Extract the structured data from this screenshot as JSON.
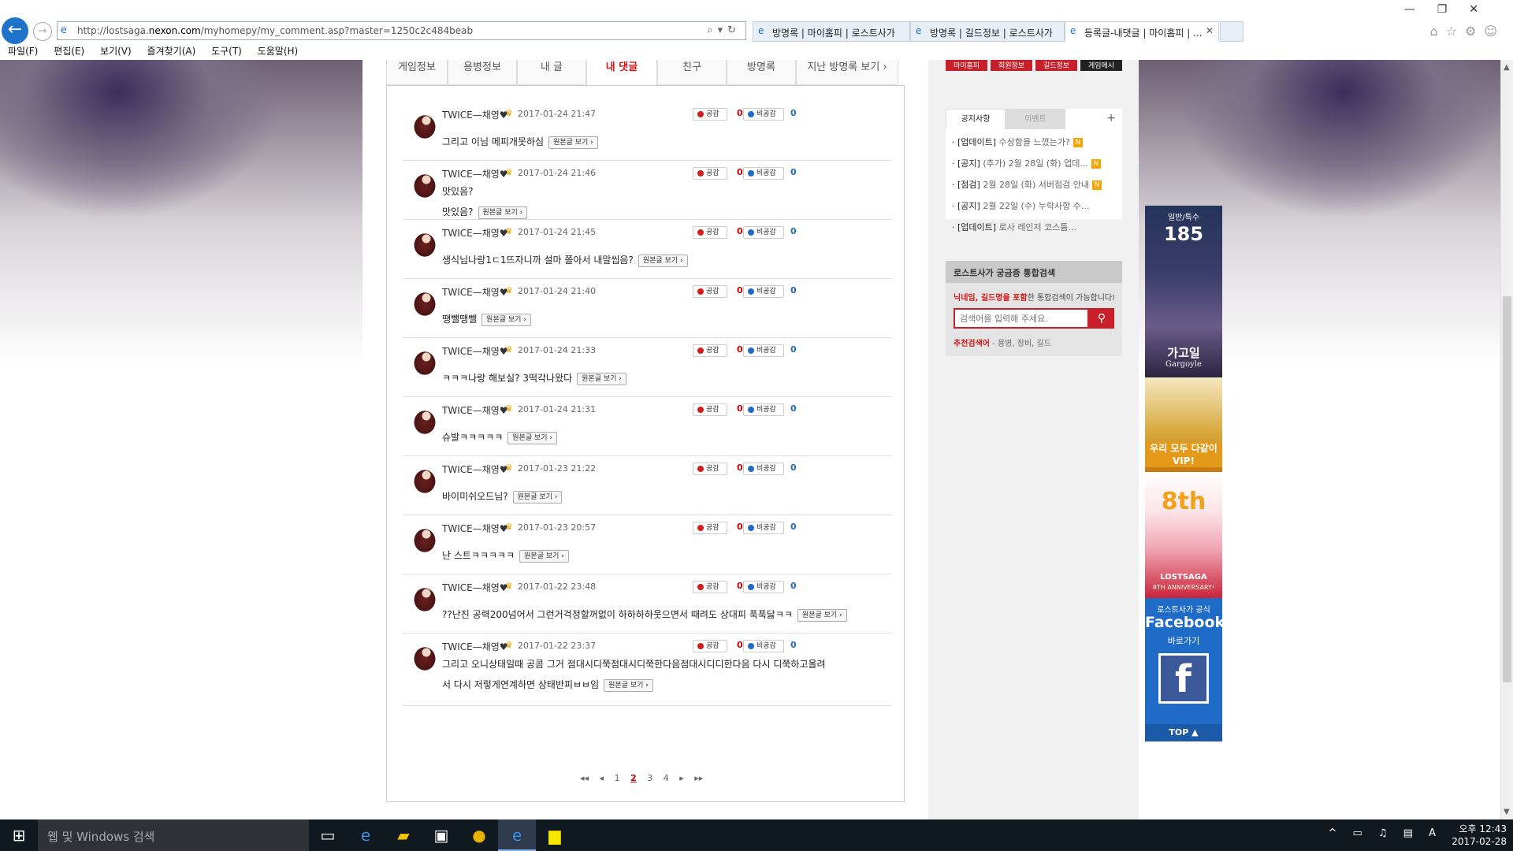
{
  "browser": {
    "url_prefix": "http://lostsaga.",
    "url_host": "nexon.com",
    "url_path": "/myhomepy/my_comment.asp?master=1250c2c484beab",
    "tabs": [
      {
        "title": "방명록 | 마이홈피 | 로스트사가"
      },
      {
        "title": "방명록 | 길드정보 | 로스트사가"
      },
      {
        "title": "등록글-내댓글 | 마이홈피 | ..."
      }
    ],
    "menu": [
      "파일(F)",
      "편집(E)",
      "보기(V)",
      "즐겨찾기(A)",
      "도구(T)",
      "도움말(H)"
    ]
  },
  "nav": {
    "tabs": [
      "게임정보",
      "용병정보",
      "내 글",
      "내 댓글",
      "친구",
      "방명록",
      "지난 방명록 보기 ›"
    ]
  },
  "comments": [
    {
      "name": "TWICE—채영♥",
      "date": "2017-01-24 21:47",
      "lines": [
        "그리고 이님 메피개못하심"
      ],
      "likes": "0",
      "dislikes": "0"
    },
    {
      "name": "TWICE—채영♥",
      "date": "2017-01-24 21:46",
      "lines": [
        "맛있음?",
        "맛있음?"
      ],
      "likes": "0",
      "dislikes": "0"
    },
    {
      "name": "TWICE—채영♥",
      "date": "2017-01-24 21:45",
      "lines": [
        "생식님나랑1ㄷ1뜨자니까 설마 쫄아서 내말씹음?"
      ],
      "likes": "0",
      "dislikes": "0"
    },
    {
      "name": "TWICE—채영♥",
      "date": "2017-01-24 21:40",
      "lines": [
        "땡뺄땡뺄"
      ],
      "likes": "0",
      "dislikes": "0"
    },
    {
      "name": "TWICE—채영♥",
      "date": "2017-01-24 21:33",
      "lines": [
        "ㅋㅋㅋ나랑 해보실? 3떡각나왔다"
      ],
      "likes": "0",
      "dislikes": "0"
    },
    {
      "name": "TWICE—채영♥",
      "date": "2017-01-24 21:31",
      "lines": [
        "슈발ㅋㅋㅋㅋㅋ"
      ],
      "likes": "0",
      "dislikes": "0"
    },
    {
      "name": "TWICE—채영♥",
      "date": "2017-01-23 21:22",
      "lines": [
        "바이미쉬오드님?"
      ],
      "likes": "0",
      "dislikes": "0"
    },
    {
      "name": "TWICE—채영♥",
      "date": "2017-01-23 20:57",
      "lines": [
        "난 스트ㅋㅋㅋㅋㅋ"
      ],
      "likes": "0",
      "dislikes": "0"
    },
    {
      "name": "TWICE—채영♥",
      "date": "2017-01-22 23:48",
      "lines": [
        "??난진 공력200넘어서 그런거걱정할꺼없이 하하하하웃으면서 때려도 상대피 푹푹닳ㅋㅋ"
      ],
      "likes": "0",
      "dislikes": "0"
    },
    {
      "name": "TWICE—채영♥",
      "date": "2017-01-22 23:37",
      "lines": [
        "그리고 오니상태일때 공콤 그거 점대시디쭉점대시디쭉한다음점대시디디한다음 다시 디쭉하고올려",
        "서 다시 저렇게연계하면 상태반피ㅂㅂ임"
      ],
      "likes": "0",
      "dislikes": "0"
    }
  ],
  "comment_ui": {
    "like_label": "공감",
    "dislike_label": "비공감",
    "original_label": "원본글 보기 ›"
  },
  "pager": {
    "first": "◂◂",
    "prev": "◂",
    "pages": [
      "1",
      "2",
      "3",
      "4"
    ],
    "current": "2",
    "next": "▸",
    "last": "▸▸"
  },
  "sidebar": {
    "top_buttons": [
      "마이홈피",
      "회원정보",
      "길드정보",
      "게임메시"
    ],
    "notice_tabs": [
      "공지사항",
      "이벤트"
    ],
    "notice_plus": "+",
    "notices": [
      {
        "cat": "[업데이트]",
        "title": "수상함을 느꼈는가?",
        "new": "N"
      },
      {
        "cat": "[공지]",
        "title": "(추가) 2월 28일 (화) 업데...",
        "new": "N"
      },
      {
        "cat": "[점검]",
        "title": "2월 28일 (화) 서버점검 안내",
        "new": "N"
      },
      {
        "cat": "[공지]",
        "title": "2월 22일 (수) 누락사항 수...",
        "new": ""
      },
      {
        "cat": "[업데이트]",
        "title": "로사 레인저 코스튬...",
        "new": ""
      }
    ],
    "search": {
      "title": "로스트사가 궁금증 통합검색",
      "desc_em": "닉네임, 길드명을 포함",
      "desc_rest": "한 통합검색이 가능합니다!",
      "placeholder": "검색어를 입력해 주세요.",
      "rec_label": "추천검색어",
      "rec_terms": "- 용병, 장비, 길드"
    }
  },
  "banners": {
    "b1_top": "일반/특수",
    "b1_num": "185",
    "b1_name": "가고일",
    "b1_en": "Gargoyle",
    "b2_text": "우리 모두 다같이 VIP!",
    "b3_num": "8th",
    "b3_title": "LOSTSAGA",
    "b3_sub": "8TH ANNIVERSARY!",
    "b4_t1": "로스트사가 공식",
    "b4_t2": "Facebook",
    "b4_t3": "바로가기",
    "b4_logo": "f",
    "top": "TOP ▲"
  },
  "taskbar": {
    "search_placeholder": "웹 및 Windows 검색",
    "time": "오후 12:43",
    "date": "2017-02-28",
    "tray": "^ ▭ ♫ ▤ A"
  }
}
